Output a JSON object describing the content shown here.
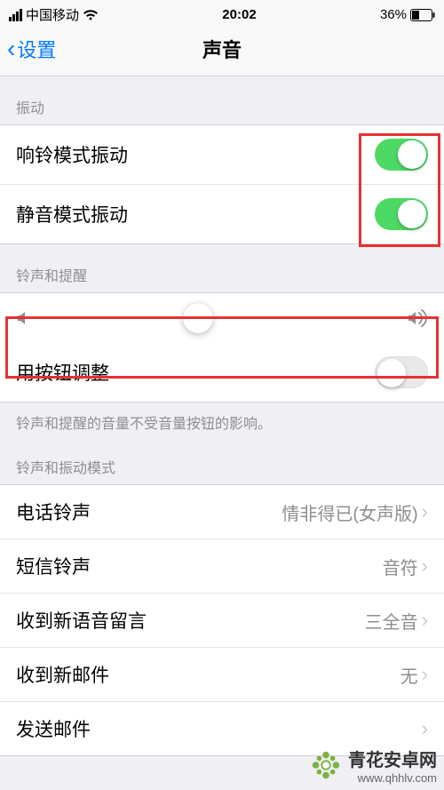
{
  "status": {
    "carrier": "中国移动",
    "time": "20:02",
    "battery_pct": "36%"
  },
  "nav": {
    "back_label": "设置",
    "title": "声音"
  },
  "sections": {
    "vibrate_header": "振动",
    "ringtone_header": "铃声和提醒",
    "patterns_header": "铃声和振动模式"
  },
  "toggles": {
    "ring_vibrate_label": "响铃模式振动",
    "ring_vibrate_on": true,
    "silent_vibrate_label": "静音模式振动",
    "silent_vibrate_on": true,
    "button_adjust_label": "用按钮调整",
    "button_adjust_on": false
  },
  "slider": {
    "value_pct": 44
  },
  "footer_note": "铃声和提醒的音量不受音量按钮的影响。",
  "rows": {
    "phone_ringtone_label": "电话铃声",
    "phone_ringtone_value": "情非得已(女声版)",
    "sms_ringtone_label": "短信铃声",
    "sms_ringtone_value": "音符",
    "new_voicemail_label": "收到新语音留言",
    "new_voicemail_value": "三全音",
    "new_mail_label": "收到新邮件",
    "new_mail_value": "无",
    "send_mail_label": "发送邮件"
  },
  "watermark": {
    "brand": "青花安卓网",
    "url": "www.qhhlv.com",
    "accent_color": "#7cb342"
  }
}
